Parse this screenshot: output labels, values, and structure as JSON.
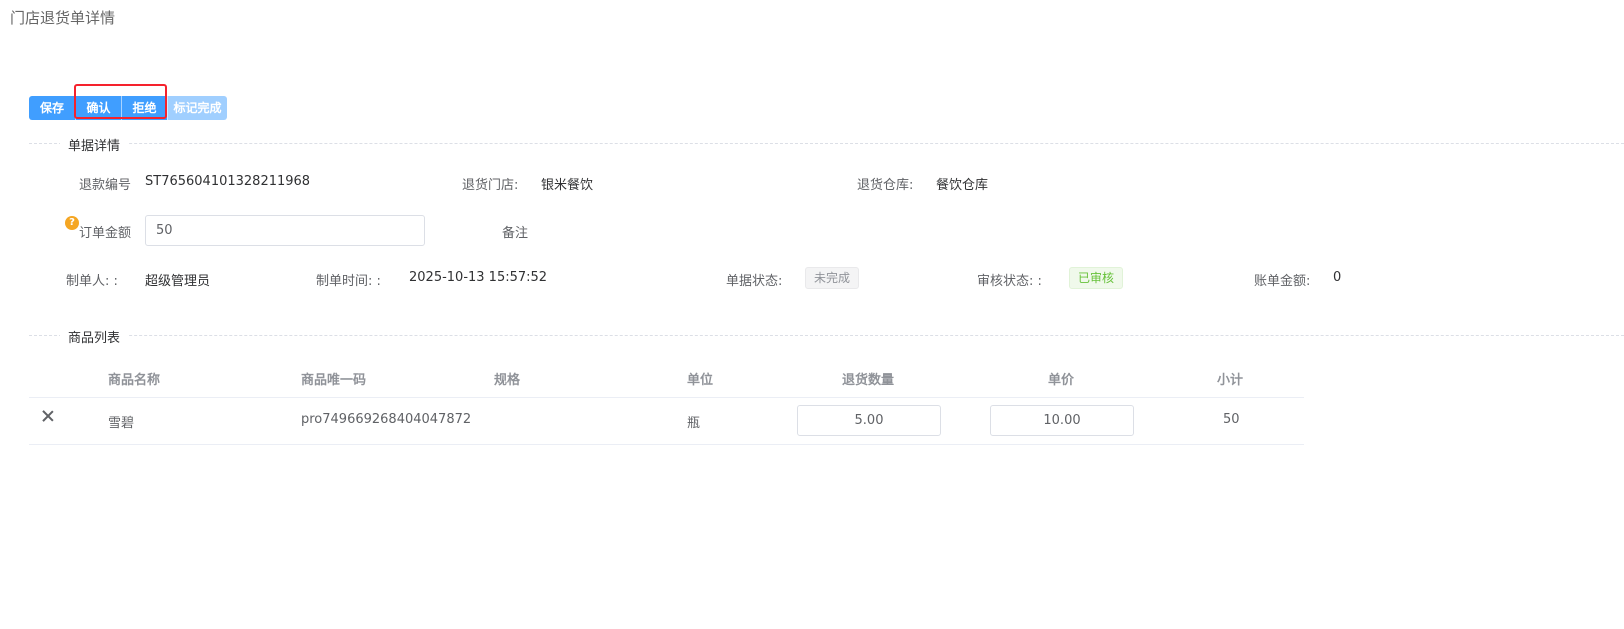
{
  "page": {
    "title": "门店退货单详情"
  },
  "toolbar": {
    "save_label": "保存",
    "confirm_label": "确认",
    "reject_label": "拒绝",
    "mark_complete_label": "标记完成"
  },
  "detail_section": {
    "title": "单据详情",
    "refund_no_label": "退款编号",
    "refund_no_value": "ST765604101328211968",
    "return_store_label": "退货门店:",
    "return_store_value": "银米餐饮",
    "return_warehouse_label": "退货仓库:",
    "return_warehouse_value": "餐饮仓库",
    "order_amount_label": "订单金额",
    "order_amount_value": "50",
    "remark_label": "备注",
    "creator_label": "制单人: :",
    "creator_value": "超级管理员",
    "created_time_label": "制单时间: :",
    "created_time_value": "2025-10-13 15:57:52",
    "doc_status_label": "单据状态:",
    "doc_status_value": "未完成",
    "audit_status_label": "审核状态: :",
    "audit_status_value": "已审核",
    "bill_amount_label": "账单金额:",
    "bill_amount_value": "0"
  },
  "product_section": {
    "title": "商品列表",
    "columns": [
      "商品名称",
      "商品唯一码",
      "规格",
      "单位",
      "退货数量",
      "单价",
      "小计"
    ],
    "rows": [
      {
        "name": "雪碧",
        "code": "pro749669268404047872",
        "spec": "",
        "unit": "瓶",
        "qty": "5.00",
        "price": "10.00",
        "subtotal": "50"
      }
    ]
  },
  "colors": {
    "primary": "#409eff",
    "primary_disabled": "#a0cfff",
    "highlight": "#f5222d",
    "success": "#67c23a",
    "warning": "#f5a623"
  }
}
